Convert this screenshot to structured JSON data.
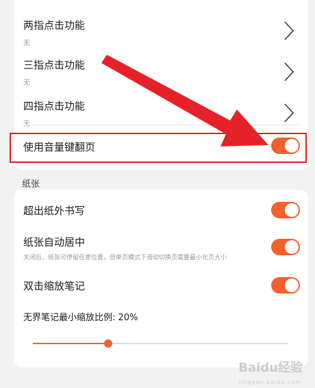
{
  "touch_settings": {
    "items": [
      {
        "title": "两指点击功能",
        "subtitle": "无"
      },
      {
        "title": "三指点击功能",
        "subtitle": "无"
      },
      {
        "title": "四指点击功能",
        "subtitle": "无"
      }
    ],
    "volume_page_turn": {
      "label": "使用音量键翻页",
      "enabled": true
    }
  },
  "paper_section": {
    "label": "纸张",
    "overflow_writing": {
      "label": "超出纸外书写",
      "enabled": true
    },
    "auto_center": {
      "label": "纸张自动居中",
      "description": "关闭后，纸张可停留任意位置，但单页模式下滑动切换页需要最小化页大小",
      "enabled": true
    },
    "double_tap_zoom": {
      "label": "双击缩放笔记",
      "enabled": true
    },
    "min_zoom": {
      "label": "无界笔记最小缩放比例: 20%",
      "value_percent": 20
    }
  },
  "colors": {
    "accent": "#f0612d",
    "highlight": "#d81e2a",
    "arrow": "#e52229"
  },
  "icons": {
    "chevron": "chevron-right-icon",
    "arrow": "red-pointer-arrow"
  },
  "watermark": {
    "text": "Baidu经验",
    "sub": "jingyan.baidu.com"
  }
}
